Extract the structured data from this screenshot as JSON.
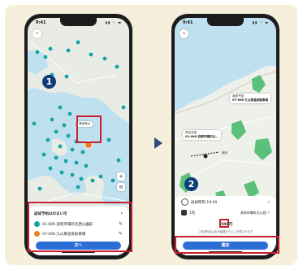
{
  "colors": {
    "accent": "#c8202f",
    "button": "#2c6dd6",
    "badge": "#0d3d78",
    "station": "#1aa3a3",
    "panel": "#f6efdc"
  },
  "phone1": {
    "time": "9:41",
    "signal_icons": "▮▮ ◠ ▬",
    "badge": "1",
    "popup": {
      "title": "港米売山",
      "subtitle": ""
    },
    "sheet": {
      "title": "返却予約はのまい可",
      "rows": [
        {
          "icon": "station-icon",
          "text": "01-006 浪岡市場町北西公園前"
        },
        {
          "icon": "station-icon",
          "text": "07-006 久山東温泉駐車場"
        }
      ],
      "next_button": "次へ"
    }
  },
  "phone2": {
    "time": "9:41",
    "signal_icons": "▮▮ ◠ ▬",
    "badge": "2",
    "map_labels": [
      {
        "title": "返却予定",
        "text": "07-006 久山東温泉駐車場"
      },
      {
        "title": "貸出予定",
        "text": "01-006 浪岡市場町北..."
      }
    ],
    "place_name": "浪岡",
    "sheet": {
      "return_time": "返却時刻 19:00",
      "rows": [
        {
          "label": "1名",
          "value": "浪岡市場町北公園"
        }
      ],
      "price": "1500円",
      "note": "ご利用料金は走行距離をもとに計算されます",
      "confirm_button": "確定"
    }
  }
}
